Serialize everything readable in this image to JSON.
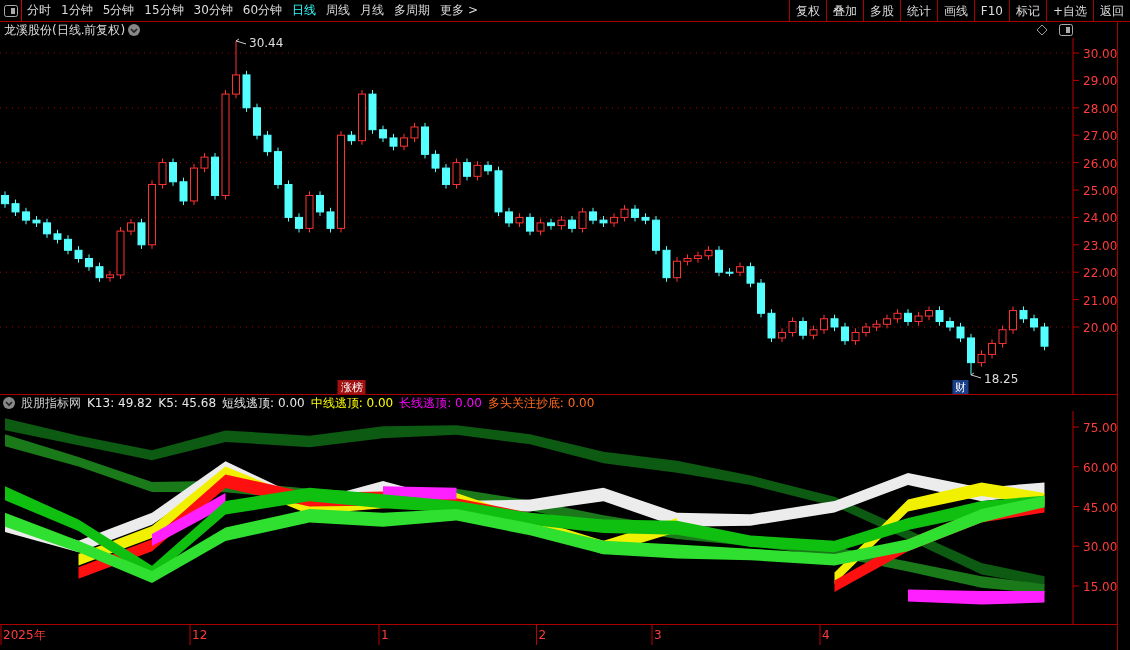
{
  "toolbar": {
    "tabs": [
      {
        "label": "分时",
        "selected": false
      },
      {
        "label": "1分钟",
        "selected": false
      },
      {
        "label": "5分钟",
        "selected": false
      },
      {
        "label": "15分钟",
        "selected": false
      },
      {
        "label": "30分钟",
        "selected": false
      },
      {
        "label": "60分钟",
        "selected": false
      },
      {
        "label": "日线",
        "selected": true
      },
      {
        "label": "周线",
        "selected": false
      },
      {
        "label": "月线",
        "selected": false
      },
      {
        "label": "多周期",
        "selected": false
      },
      {
        "label": "更多 >",
        "selected": false
      }
    ],
    "buttons": [
      "复权",
      "叠加",
      "多股",
      "统计",
      "画线",
      "F10",
      "标记",
      "+自选",
      "返回"
    ]
  },
  "price_panel": {
    "title": "龙溪股份(日线.前复权)",
    "axis_labels": [
      "30.00",
      "29.00",
      "28.00",
      "27.00",
      "26.00",
      "25.00",
      "24.00",
      "23.00",
      "22.00",
      "21.00",
      "20.00"
    ],
    "markers": [
      {
        "kind": "high",
        "label": "30.44"
      },
      {
        "kind": "low",
        "label": "18.25"
      }
    ],
    "tags": [
      {
        "label": "涨榜",
        "color": "#a01010"
      },
      {
        "label": "财",
        "color": "#1a3f8a"
      }
    ]
  },
  "indicator_panel": {
    "name": "股朋指标网",
    "readings": [
      {
        "label": "K13: 49.82",
        "color": "#e8e8e8"
      },
      {
        "label": "K5: 45.68",
        "color": "#e8e8e8"
      },
      {
        "label": "短线逃顶: 0.00",
        "color": "#e8e8e8"
      },
      {
        "label": "中线逃顶: 0.00",
        "color": "#ffff00"
      },
      {
        "label": "长线逃顶: 0.00",
        "color": "#ff00ff"
      },
      {
        "label": "多头关注抄底: 0.00",
        "color": "#ff6a1a"
      }
    ],
    "axis_labels": [
      "75.00",
      "60.00",
      "45.00",
      "30.00",
      "15.00"
    ]
  },
  "date_axis": {
    "labels": [
      "2025年",
      "12",
      "1",
      "2",
      "3",
      "4"
    ]
  }
}
